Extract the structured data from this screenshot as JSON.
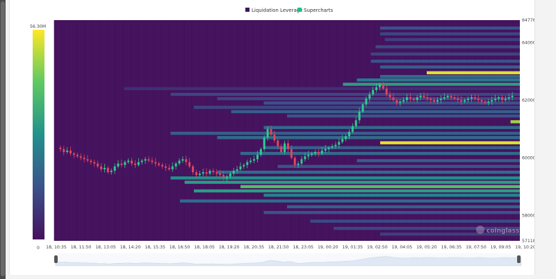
{
  "chart_data": {
    "type": "heatmap",
    "legend": [
      {
        "label": "Liquidation Leverage",
        "color": "#3b1a5a"
      },
      {
        "label": "Supercharts",
        "color": "#1fbf8a"
      }
    ],
    "colorbar": {
      "max_label": "56.30M",
      "min_label": "0",
      "colors": [
        "#45105e",
        "#3b528b",
        "#21918c",
        "#5ec962",
        "#fde725"
      ]
    },
    "y_ticks": [
      "64776",
      "64000",
      "62000",
      "60000",
      "58000",
      "57118"
    ],
    "y_tick_values": [
      64776,
      64000,
      62000,
      60000,
      58000,
      57118
    ],
    "ylim": [
      57118,
      64776
    ],
    "x_ticks": [
      "18, 10:35",
      "18, 11:50",
      "18, 13:05",
      "18, 14:20",
      "18, 15:35",
      "18, 16:50",
      "18, 18:05",
      "18, 19:20",
      "18, 20:35",
      "18, 21:50",
      "18, 23:05",
      "19, 00:20",
      "19, 01:35",
      "19, 02:50",
      "19, 04:05",
      "19, 05:20",
      "19, 06:35",
      "19, 07:50",
      "19, 09:05",
      "19, 10:20"
    ],
    "price_series": [
      60350,
      60300,
      60200,
      60250,
      60150,
      60100,
      60050,
      60000,
      59950,
      59900,
      59850,
      59800,
      59700,
      59600,
      59650,
      59500,
      59550,
      59700,
      59800,
      59750,
      59850,
      59900,
      59800,
      59750,
      59850,
      59900,
      59950,
      59900,
      59850,
      59800,
      59750,
      59700,
      59650,
      59600,
      59700,
      59800,
      59900,
      59950,
      59850,
      59700,
      59500,
      59400,
      59450,
      59500,
      59450,
      59550,
      59500,
      59450,
      59400,
      59300,
      59350,
      59450,
      59550,
      59600,
      59700,
      59750,
      59850,
      59900,
      59950,
      60100,
      60300,
      60700,
      61000,
      60800,
      60600,
      60400,
      60200,
      60500,
      60300,
      60000,
      59750,
      59800,
      59950,
      60050,
      60100,
      60150,
      60200,
      60150,
      60250,
      60300,
      60350,
      60400,
      60450,
      60550,
      60650,
      60750,
      60900,
      61100,
      61300,
      61600,
      61850,
      62050,
      62200,
      62350,
      62450,
      62550,
      62400,
      62200,
      62100,
      62000,
      61900,
      61950,
      62000,
      62100,
      62050,
      62000,
      62100,
      62150,
      62100,
      62050,
      62000,
      61950,
      62000,
      62050,
      62100,
      62150,
      62100,
      62050,
      62000,
      61950,
      62000,
      62050,
      62100,
      62050,
      62000,
      61950,
      61900,
      61950,
      62000,
      62050,
      62100,
      62000,
      62050,
      62100,
      62150
    ],
    "liquidation_bands": [
      {
        "price": 64500,
        "start": 0.7,
        "intensity": 0.25
      },
      {
        "price": 64300,
        "start": 0.7,
        "intensity": 0.2
      },
      {
        "price": 64100,
        "start": 0.71,
        "intensity": 0.18
      },
      {
        "price": 63850,
        "start": 0.69,
        "intensity": 0.22
      },
      {
        "price": 63600,
        "start": 0.68,
        "intensity": 0.2
      },
      {
        "price": 63350,
        "start": 0.68,
        "intensity": 0.25
      },
      {
        "price": 63150,
        "start": 0.7,
        "intensity": 0.3
      },
      {
        "price": 62950,
        "start": 0.8,
        "intensity": 0.95
      },
      {
        "price": 62820,
        "start": 0.7,
        "intensity": 0.35
      },
      {
        "price": 62700,
        "start": 0.65,
        "intensity": 0.4
      },
      {
        "price": 62550,
        "start": 0.62,
        "intensity": 0.55
      },
      {
        "price": 62400,
        "start": 0.15,
        "intensity": 0.12
      },
      {
        "price": 62200,
        "start": 0.25,
        "intensity": 0.2
      },
      {
        "price": 62050,
        "start": 0.35,
        "intensity": 0.2
      },
      {
        "price": 61900,
        "start": 0.45,
        "intensity": 0.25
      },
      {
        "price": 61750,
        "start": 0.3,
        "intensity": 0.2
      },
      {
        "price": 61600,
        "start": 0.38,
        "intensity": 0.3
      },
      {
        "price": 61450,
        "start": 0.5,
        "intensity": 0.25
      },
      {
        "price": 61250,
        "start": 0.98,
        "intensity": 0.85
      },
      {
        "price": 61050,
        "start": 0.45,
        "intensity": 0.35
      },
      {
        "price": 60850,
        "start": 0.25,
        "intensity": 0.3
      },
      {
        "price": 60700,
        "start": 0.35,
        "intensity": 0.35
      },
      {
        "price": 60520,
        "start": 0.7,
        "intensity": 0.95
      },
      {
        "price": 60350,
        "start": 0.45,
        "intensity": 0.3
      },
      {
        "price": 60150,
        "start": 0.4,
        "intensity": 0.35
      },
      {
        "price": 59900,
        "start": 0.65,
        "intensity": 0.3
      },
      {
        "price": 59700,
        "start": 0.48,
        "intensity": 0.25
      },
      {
        "price": 59500,
        "start": 0.35,
        "intensity": 0.35
      },
      {
        "price": 59300,
        "start": 0.25,
        "intensity": 0.5
      },
      {
        "price": 59150,
        "start": 0.28,
        "intensity": 0.55
      },
      {
        "price": 59000,
        "start": 0.4,
        "intensity": 0.7
      },
      {
        "price": 58850,
        "start": 0.3,
        "intensity": 0.55
      },
      {
        "price": 58700,
        "start": 0.45,
        "intensity": 0.45
      },
      {
        "price": 58500,
        "start": 0.27,
        "intensity": 0.35
      },
      {
        "price": 58300,
        "start": 0.5,
        "intensity": 0.3
      },
      {
        "price": 58100,
        "start": 0.45,
        "intensity": 0.25
      },
      {
        "price": 57800,
        "start": 0.55,
        "intensity": 0.22
      },
      {
        "price": 57550,
        "start": 0.6,
        "intensity": 0.2
      },
      {
        "price": 57350,
        "start": 0.7,
        "intensity": 0.18
      }
    ],
    "grid": false
  },
  "watermark": "coinglass"
}
